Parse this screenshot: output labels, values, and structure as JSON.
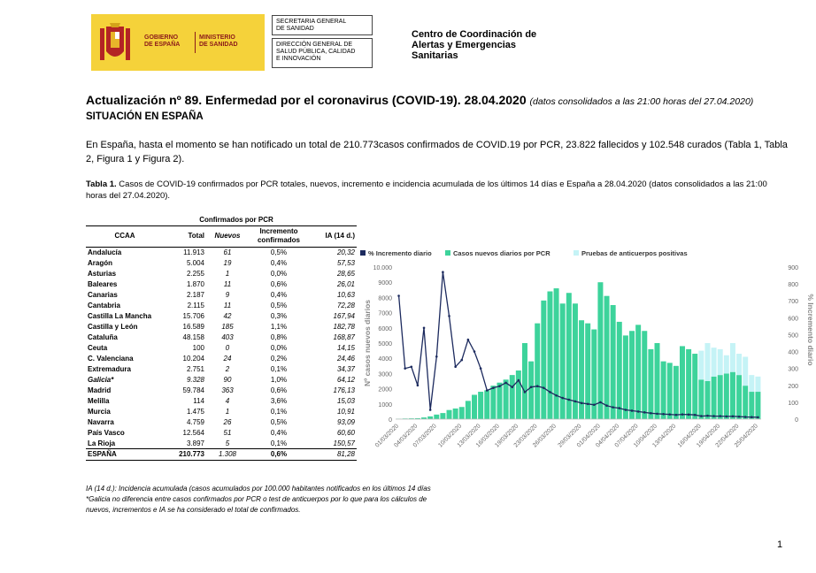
{
  "header": {
    "gov_left": [
      "GOBIERNO",
      "DE ESPAÑA"
    ],
    "gov_right": [
      "MINISTERIO",
      "DE SANIDAD"
    ],
    "secretaria": [
      "SECRETARIA GENERAL",
      "DE SANIDAD"
    ],
    "direccion": [
      "DIRECCIÓN GENERAL DE",
      "SALUD PÚBLICA, CALIDAD",
      "E INNOVACIÓN"
    ],
    "centro": [
      "Centro de Coordinación de",
      "Alertas y Emergencias",
      "Sanitarias"
    ]
  },
  "title": "Actualización nº 89. Enfermedad por el coronavirus (COVID-19). 28.04.2020",
  "title_sub": "(datos consolidados a las 21:00 horas del 27.04.2020)",
  "section": "SITUACIÓN EN ESPAÑA",
  "intro": "En España, hasta el momento se han notificado un total de 210.773casos confirmados de COVID.19 por PCR, 23.822 fallecidos y 102.548 curados (Tabla 1, Tabla 2, Figura 1 y Figura 2).",
  "table_caption_label": "Tabla 1.",
  "table_caption": " Casos de COVID-19 confirmados por PCR totales, nuevos, incremento e incidencia acumulada de los últimos 14 días e España a 28.04.2020 (datos consolidados a las 21:00 horas del 27.04.2020).",
  "table": {
    "group_header": "Confirmados por PCR",
    "headers": [
      "CCAA",
      "Total",
      "Nuevos",
      "Incremento confirmados",
      "IA (14 d.)"
    ],
    "rows": [
      {
        "ccaa": "Andalucía",
        "total": "11.913",
        "nuevos": "61",
        "inc": "0,5%",
        "ia": "20,32"
      },
      {
        "ccaa": "Aragón",
        "total": "5.004",
        "nuevos": "19",
        "inc": "0,4%",
        "ia": "57,53"
      },
      {
        "ccaa": "Asturias",
        "total": "2.255",
        "nuevos": "1",
        "inc": "0,0%",
        "ia": "28,65"
      },
      {
        "ccaa": "Baleares",
        "total": "1.870",
        "nuevos": "11",
        "inc": "0,6%",
        "ia": "26,01"
      },
      {
        "ccaa": "Canarias",
        "total": "2.187",
        "nuevos": "9",
        "inc": "0,4%",
        "ia": "10,63"
      },
      {
        "ccaa": "Cantabria",
        "total": "2.115",
        "nuevos": "11",
        "inc": "0,5%",
        "ia": "72,28"
      },
      {
        "ccaa": "Castilla La Mancha",
        "total": "15.706",
        "nuevos": "42",
        "inc": "0,3%",
        "ia": "167,94"
      },
      {
        "ccaa": "Castilla y León",
        "total": "16.589",
        "nuevos": "185",
        "inc": "1,1%",
        "ia": "182,78"
      },
      {
        "ccaa": "Cataluña",
        "total": "48.158",
        "nuevos": "403",
        "inc": "0,8%",
        "ia": "168,87"
      },
      {
        "ccaa": "Ceuta",
        "total": "100",
        "nuevos": "0",
        "inc": "0,0%",
        "ia": "14,15"
      },
      {
        "ccaa": "C. Valenciana",
        "total": "10.204",
        "nuevos": "24",
        "inc": "0,2%",
        "ia": "24,46"
      },
      {
        "ccaa": "Extremadura",
        "total": "2.751",
        "nuevos": "2",
        "inc": "0,1%",
        "ia": "34,37"
      },
      {
        "ccaa": "Galicia*",
        "total": "9.328",
        "nuevos": "90",
        "inc": "1,0%",
        "ia": "64,12",
        "italic": true
      },
      {
        "ccaa": "Madrid",
        "total": "59.784",
        "nuevos": "363",
        "inc": "0,6%",
        "ia": "176,13"
      },
      {
        "ccaa": "Melilla",
        "total": "114",
        "nuevos": "4",
        "inc": "3,6%",
        "ia": "15,03"
      },
      {
        "ccaa": "Murcia",
        "total": "1.475",
        "nuevos": "1",
        "inc": "0,1%",
        "ia": "10,91"
      },
      {
        "ccaa": "Navarra",
        "total": "4.759",
        "nuevos": "26",
        "inc": "0,5%",
        "ia": "93,09"
      },
      {
        "ccaa": "País Vasco",
        "total": "12.564",
        "nuevos": "51",
        "inc": "0,4%",
        "ia": "60,60"
      },
      {
        "ccaa": "La Rioja",
        "total": "3.897",
        "nuevos": "5",
        "inc": "0,1%",
        "ia": "150,57"
      }
    ],
    "total_row": {
      "ccaa": "ESPAÑA",
      "total": "210.773",
      "nuevos": "1.308",
      "inc": "0,6%",
      "ia": "81,28"
    }
  },
  "notes": [
    "IA (14 d.): Incidencia acumulada (casos acumulados por 100.000 habitantes notificados en los últimos 14 días",
    "*Galicia no diferencia entre casos confirmados por PCR o test de anticuerpos por lo que para los cálculos de nuevos, incrementos e IA se ha considerado el total de confirmados."
  ],
  "page_number": "1",
  "colors": {
    "bar": "#3dd39b",
    "antibody": "#c5f3f6",
    "line": "#1c2a5e",
    "crest_red": "#b32424",
    "gov_yellow": "#f5d23a"
  },
  "chart_data": {
    "type": "bar",
    "legend": [
      "% Incremento diario",
      "Casos nuevos diarios por PCR",
      "Pruebas de anticuerpos positivas"
    ],
    "legend_position": "top",
    "ylabel": "Nº casos nuevos diarios",
    "y2label": "% Incremento diario",
    "ylim": [
      0,
      10000
    ],
    "y2lim": [
      0,
      900
    ],
    "yticks": [
      "0",
      "1000",
      "2000",
      "3000",
      "4000",
      "5000",
      "6000",
      "7000",
      "8000",
      "9000",
      "10.000"
    ],
    "y2ticks": [
      "0",
      "100",
      "200",
      "300",
      "400",
      "500",
      "600",
      "700",
      "800",
      "900"
    ],
    "xtick_labels": [
      "01/03/2020",
      "04/03/2020",
      "07/03/2020",
      "10/03/2020",
      "13/03/2020",
      "16/03/2020",
      "19/03/2020",
      "23/03/2020",
      "26/03/2020",
      "29/03/2020",
      "01/04/2020",
      "04/04/2020",
      "07/04/2020",
      "10/04/2020",
      "13/04/2020",
      "16/04/2020",
      "19/04/2020",
      "22/04/2020",
      "25/04/2020"
    ],
    "series": [
      {
        "name": "Casos nuevos diarios por PCR",
        "values": [
          20,
          40,
          50,
          60,
          110,
          180,
          300,
          400,
          600,
          700,
          800,
          1200,
          1600,
          1800,
          1900,
          2200,
          2400,
          2600,
          2900,
          3200,
          5000,
          3800,
          6300,
          7800,
          8400,
          8600,
          7600,
          8300,
          7600,
          6500,
          6300,
          5900,
          9000,
          8100,
          7500,
          6400,
          5500,
          5800,
          6200,
          5800,
          4600,
          5000,
          3800,
          3700,
          3500,
          4800,
          4600,
          4300,
          2600,
          2500,
          2800,
          2900,
          3000,
          3100,
          2900,
          2200,
          1800,
          1800
        ]
      },
      {
        "name": "Pruebas de anticuerpos positivas",
        "values": [
          0,
          0,
          0,
          0,
          0,
          0,
          0,
          0,
          0,
          0,
          0,
          0,
          0,
          0,
          0,
          0,
          0,
          0,
          0,
          0,
          0,
          0,
          0,
          0,
          0,
          0,
          0,
          0,
          0,
          0,
          0,
          0,
          0,
          0,
          0,
          0,
          0,
          0,
          0,
          0,
          0,
          0,
          0,
          0,
          0,
          0,
          0,
          0,
          1900,
          2500,
          1900,
          1700,
          1200,
          1900,
          1400,
          1900,
          1100,
          1000
        ]
      },
      {
        "name": "% Incremento diario",
        "axis": "right",
        "values": [
          730,
          300,
          310,
          200,
          540,
          55,
          370,
          870,
          610,
          310,
          350,
          470,
          400,
          300,
          170,
          185,
          195,
          215,
          190,
          230,
          160,
          190,
          195,
          185,
          160,
          140,
          125,
          115,
          105,
          95,
          90,
          85,
          100,
          80,
          70,
          65,
          55,
          50,
          45,
          40,
          35,
          32,
          30,
          28,
          25,
          28,
          27,
          25,
          18,
          20,
          18,
          18,
          16,
          17,
          15,
          13,
          12,
          11
        ]
      }
    ]
  }
}
